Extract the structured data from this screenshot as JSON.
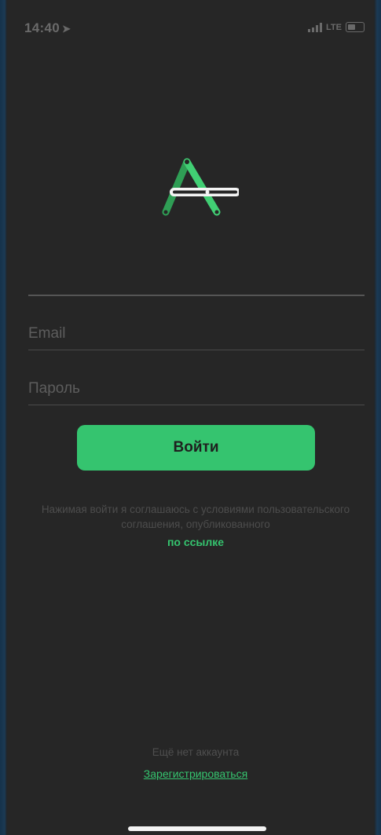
{
  "status_bar": {
    "time": "14:40",
    "network": "LTE"
  },
  "login_form": {
    "email_placeholder": "Email",
    "password_placeholder": "Пароль",
    "login_button": "Войти"
  },
  "terms": {
    "text": "Нажимая войти я соглашаюсь с условиями пользовательского соглашения, опубликованного",
    "link": "по ссылке"
  },
  "footer": {
    "no_account": "Ещё нет аккаунта",
    "register_link": "Зарегистрироваться"
  },
  "colors": {
    "accent": "#35c46f",
    "background": "#262626"
  },
  "icons": [
    "location-arrow-icon",
    "signal-icon",
    "battery-icon",
    "app-logo"
  ]
}
